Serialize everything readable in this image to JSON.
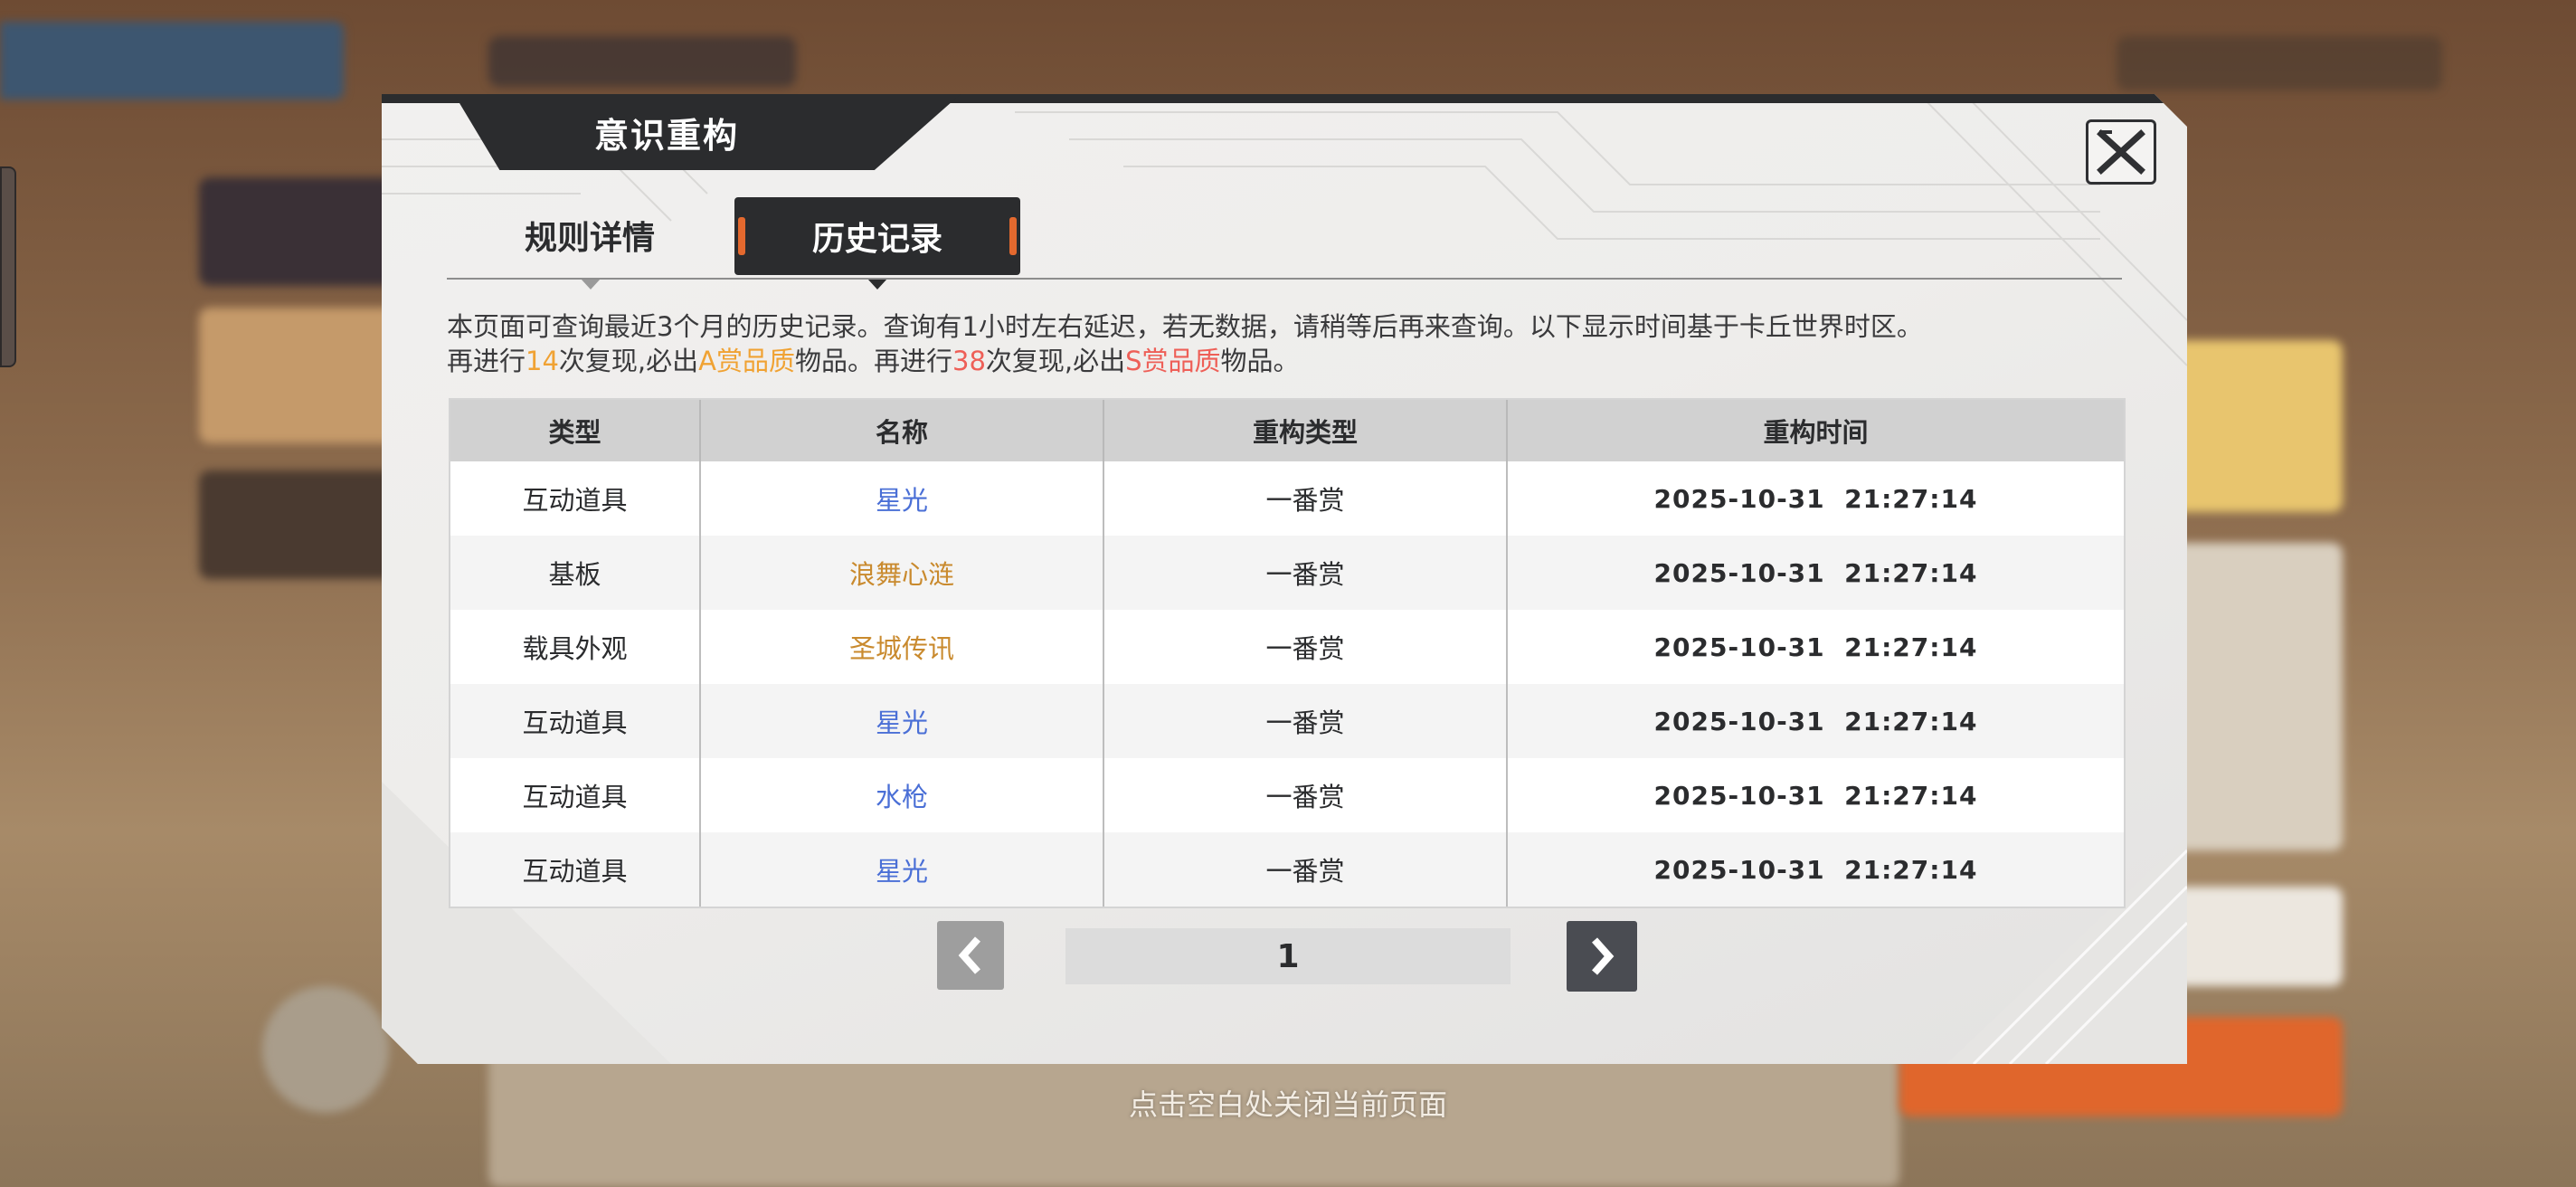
{
  "dialog": {
    "title": "意识重构",
    "close_icon": "close-x-icon"
  },
  "tabs": [
    {
      "label": "规则详情",
      "active": false
    },
    {
      "label": "历史记录",
      "active": true
    }
  ],
  "notice": {
    "line1": "本页面可查询最近3个月的历史记录。查询有1小时左右延迟，若无数据，请稍等后再来查询。以下显示时间基于卡丘世界时区。",
    "line2_part1": "再进行",
    "a_count": "14",
    "line2_part2": "次复现,必出",
    "a_grade": "A赏品质",
    "line2_part3": "物品。再进行",
    "s_count": "38",
    "line2_part4": "次复现,必出",
    "s_grade": "S赏品质",
    "line2_part5": "物品。"
  },
  "colors": {
    "orange": "#f0a233",
    "red": "#ee5f57",
    "name_blue": "#4a6fd6",
    "name_gold": "#c98a2e",
    "dark": "#2b2c2e"
  },
  "table": {
    "columns": [
      "类型",
      "名称",
      "重构类型",
      "重构时间"
    ],
    "rows": [
      {
        "type": "互动道具",
        "name": "星光",
        "name_color": "blue",
        "rebuild_type": "一番赏",
        "time": "2025-10-31  21:27:14"
      },
      {
        "type": "基板",
        "name": "浪舞心涟",
        "name_color": "gold",
        "rebuild_type": "一番赏",
        "time": "2025-10-31  21:27:14"
      },
      {
        "type": "载具外观",
        "name": "圣城传讯",
        "name_color": "gold",
        "rebuild_type": "一番赏",
        "time": "2025-10-31  21:27:14"
      },
      {
        "type": "互动道具",
        "name": "星光",
        "name_color": "blue",
        "rebuild_type": "一番赏",
        "time": "2025-10-31  21:27:14"
      },
      {
        "type": "互动道具",
        "name": "水枪",
        "name_color": "blue",
        "rebuild_type": "一番赏",
        "time": "2025-10-31  21:27:14"
      },
      {
        "type": "互动道具",
        "name": "星光",
        "name_color": "blue",
        "rebuild_type": "一番赏",
        "time": "2025-10-31  21:27:14"
      }
    ]
  },
  "pagination": {
    "current_page": "1",
    "prev_icon": "chevron-left-icon",
    "next_icon": "chevron-right-icon"
  },
  "footer": {
    "close_hint": "点击空白处关闭当前页面"
  }
}
